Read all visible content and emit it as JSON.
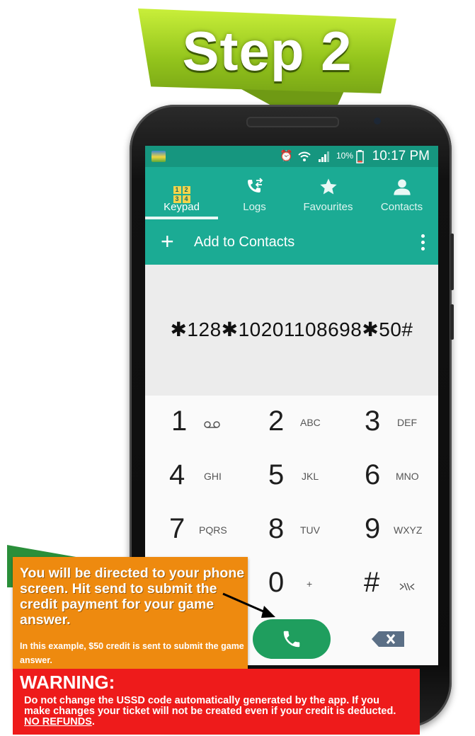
{
  "banner": {
    "title": "Step 2"
  },
  "status_bar": {
    "battery": "10%",
    "time": "10:17 PM"
  },
  "tabs": [
    {
      "label": "Keypad",
      "icon": "keypad-icon",
      "active": true,
      "digits": [
        "1",
        "2",
        "3",
        "4"
      ]
    },
    {
      "label": "Logs",
      "icon": "call-log-icon",
      "active": false
    },
    {
      "label": "Favourites",
      "icon": "star-icon",
      "active": false
    },
    {
      "label": "Contacts",
      "icon": "person-icon",
      "active": false
    }
  ],
  "add_bar": {
    "label": "Add to Contacts"
  },
  "dialed_number": "✱128✱10201108698✱50#",
  "keys": [
    {
      "digit": "1",
      "letters": "voicemail-icon"
    },
    {
      "digit": "2",
      "letters": "ABC"
    },
    {
      "digit": "3",
      "letters": "DEF"
    },
    {
      "digit": "4",
      "letters": "GHI"
    },
    {
      "digit": "5",
      "letters": "JKL"
    },
    {
      "digit": "6",
      "letters": "MNO"
    },
    {
      "digit": "7",
      "letters": "PQRS"
    },
    {
      "digit": "8",
      "letters": "TUV"
    },
    {
      "digit": "9",
      "letters": "WXYZ"
    },
    {
      "digit": "0",
      "letters": "+"
    },
    {
      "digit": "#",
      "letters": "signal-icon"
    }
  ],
  "instruction": {
    "main": "You will be directed to your phone screen. Hit send to submit the credit payment for your game answer.",
    "example": "In this example, $50 credit is sent to submit the game answer."
  },
  "warning": {
    "title": "WARNING:",
    "body": "Do not change the USSD code automatically generated by the app. If you make changes your ticket will not be created even if your credit is deducted.",
    "emphasis": "NO REFUNDS",
    "period": "."
  },
  "colors": {
    "banner_green": "#93c41c",
    "teal_header": "#1bab94",
    "status_teal": "#16967f",
    "call_green": "#1f9e5e",
    "orange_box": "#ee8a0f",
    "warning_red": "#ee1b1b"
  }
}
